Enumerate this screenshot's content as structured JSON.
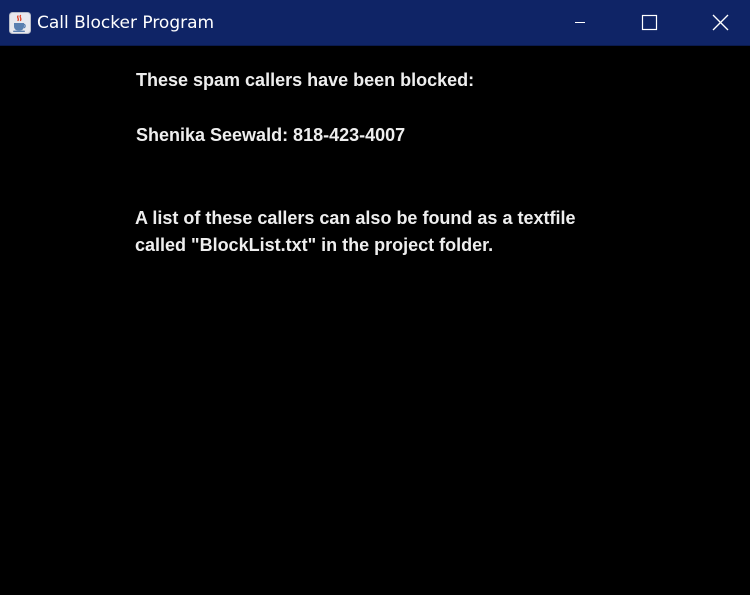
{
  "window": {
    "title": "Call Blocker Program",
    "app_icon": "java-cup-icon",
    "controls": {
      "minimize_icon": "minimize-icon",
      "maximize_icon": "maximize-icon",
      "close_icon": "close-icon"
    },
    "colors": {
      "titlebar": "#0f2466",
      "background": "#000000",
      "text": "#eeeeee"
    }
  },
  "content": {
    "heading": "These spam callers have been blocked:",
    "blocked_callers": [
      "Shenika Seewald: 818-423-4007"
    ],
    "note_lines": [
      "A list of these callers can also be found as a textfile",
      "called \"BlockList.txt\" in the project folder."
    ]
  }
}
